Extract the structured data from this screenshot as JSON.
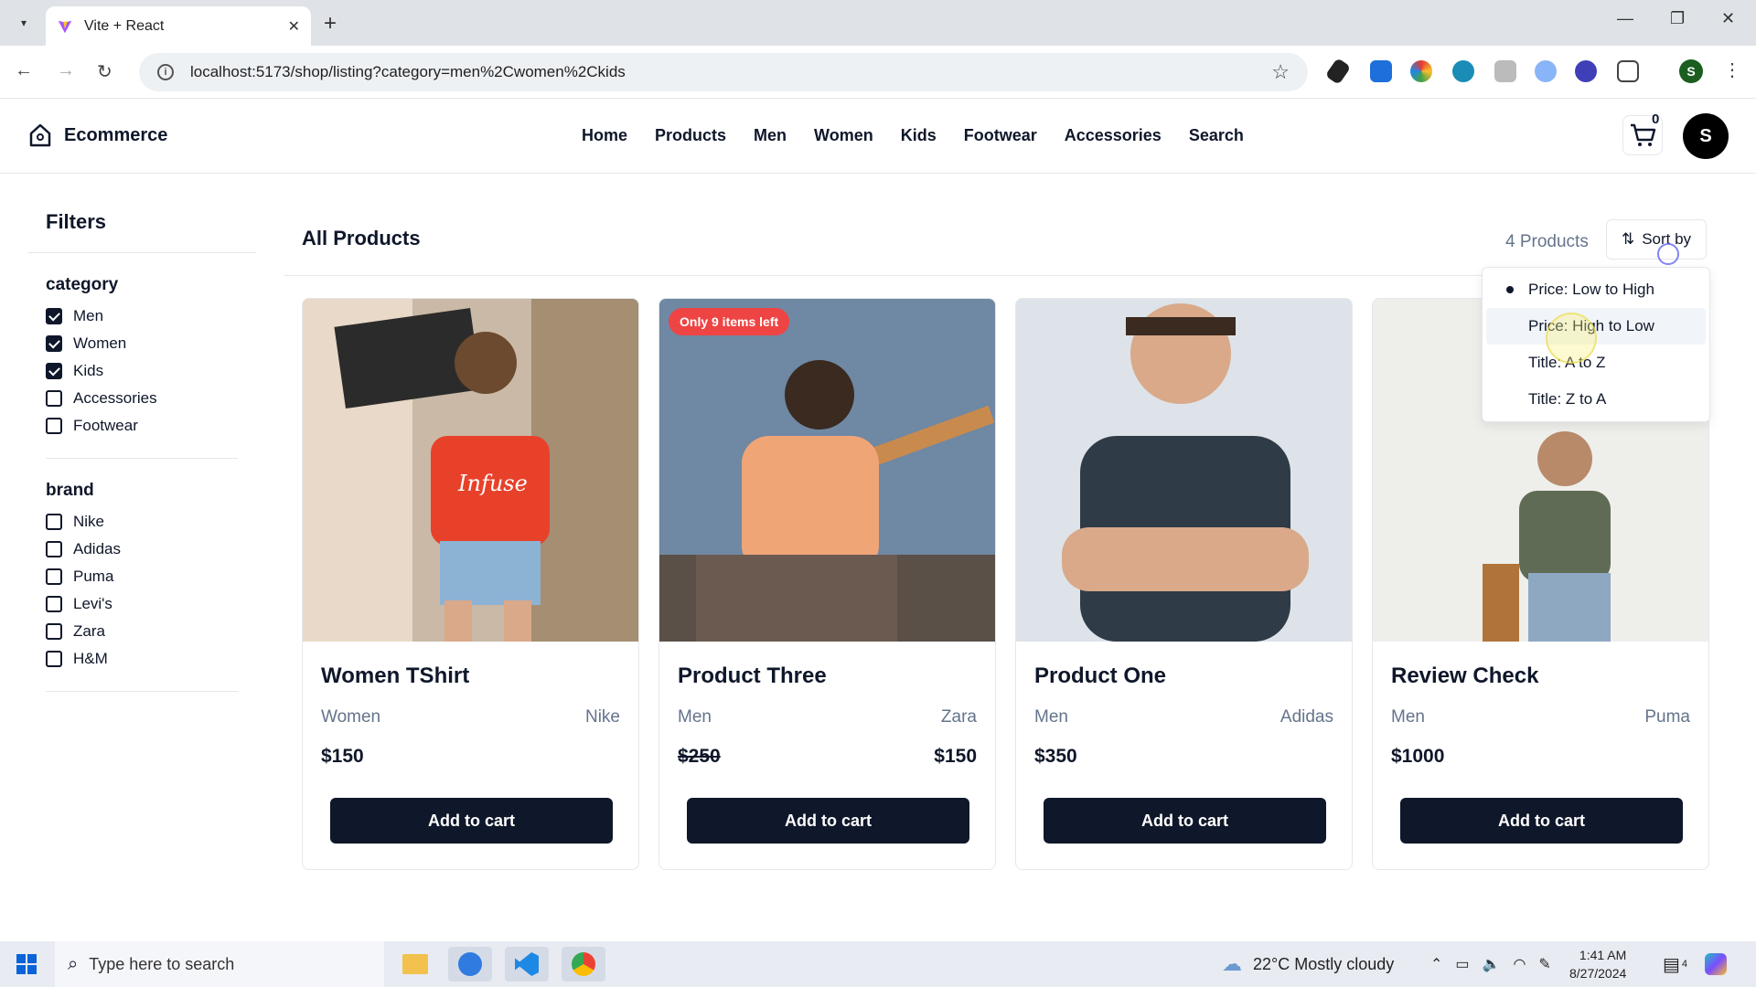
{
  "browser": {
    "tab_title": "Vite + React",
    "url": "localhost:5173/shop/listing?category=men%2Cwomen%2Ckids"
  },
  "site": {
    "brand": "Ecommerce",
    "nav": [
      "Home",
      "Products",
      "Men",
      "Women",
      "Kids",
      "Footwear",
      "Accessories",
      "Search"
    ],
    "cart_count": "0",
    "avatar_initial": "S"
  },
  "filters": {
    "title": "Filters",
    "category": {
      "label": "category",
      "options": [
        {
          "label": "Men",
          "checked": true
        },
        {
          "label": "Women",
          "checked": true
        },
        {
          "label": "Kids",
          "checked": true
        },
        {
          "label": "Accessories",
          "checked": false
        },
        {
          "label": "Footwear",
          "checked": false
        }
      ]
    },
    "brand": {
      "label": "brand",
      "options": [
        {
          "label": "Nike",
          "checked": false
        },
        {
          "label": "Adidas",
          "checked": false
        },
        {
          "label": "Puma",
          "checked": false
        },
        {
          "label": "Levi's",
          "checked": false
        },
        {
          "label": "Zara",
          "checked": false
        },
        {
          "label": "H&M",
          "checked": false
        }
      ]
    }
  },
  "listing": {
    "title": "All Products",
    "count_text": "4 Products",
    "sort_label": "Sort by",
    "sort_options": [
      "Price: Low to High",
      "Price: High to Low",
      "Title: A to Z",
      "Title: Z to A"
    ],
    "sort_selected": "Price: Low to High",
    "sort_hovered": "Price: High to Low",
    "add_label": "Add to cart",
    "products": [
      {
        "title": "Women TShirt",
        "category": "Women",
        "brand": "Nike",
        "price": "$150",
        "sale_price": "",
        "badge": ""
      },
      {
        "title": "Product Three",
        "category": "Men",
        "brand": "Zara",
        "price": "$250",
        "sale_price": "$150",
        "badge": "Only 9 items left"
      },
      {
        "title": "Product One",
        "category": "Men",
        "brand": "Adidas",
        "price": "$350",
        "sale_price": "",
        "badge": ""
      },
      {
        "title": "Review Check",
        "category": "Men",
        "brand": "Puma",
        "price": "$1000",
        "sale_price": "",
        "badge": ""
      }
    ]
  },
  "taskbar": {
    "search_placeholder": "Type here to search",
    "weather": "22°C  Mostly cloudy",
    "time": "1:41 AM",
    "date": "8/27/2024",
    "notif_count": "4"
  }
}
